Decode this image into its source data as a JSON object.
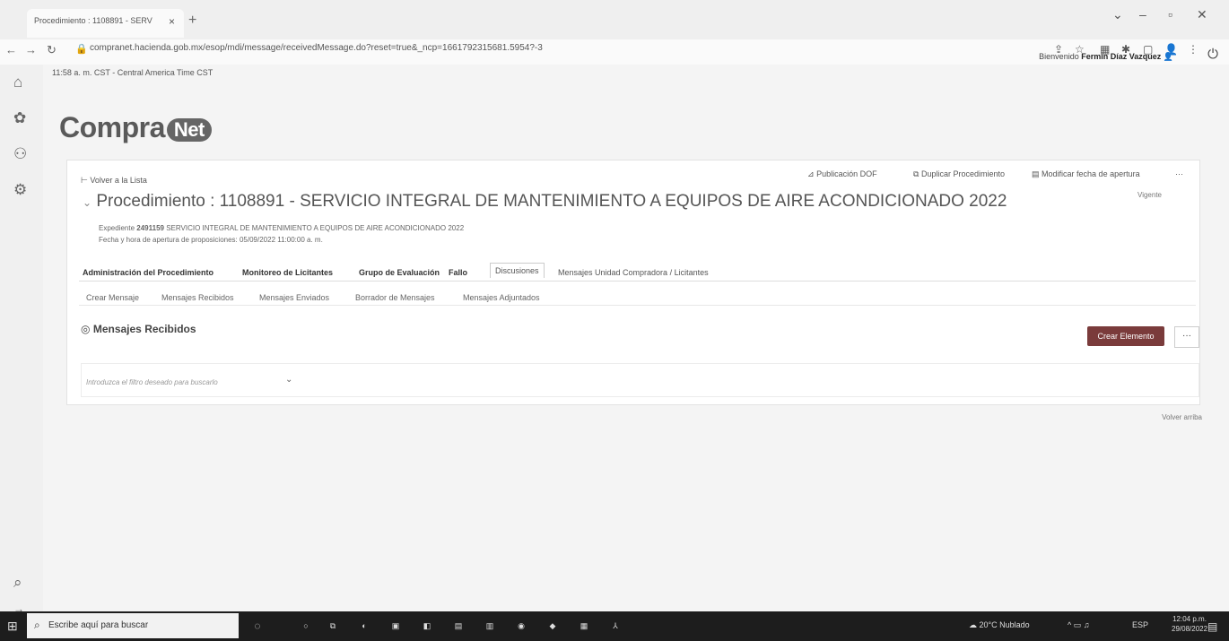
{
  "browser": {
    "tab_title": "Procedimiento : 1108891 - SERV",
    "url": "compranet.hacienda.gob.mx/esop/mdi/message/receivedMessage.do?reset=true&_ncp=1661792315681.5954?-3"
  },
  "header": {
    "welcome_prefix": "Bienvenido",
    "user_name": "Fermín Díaz Vazquez",
    "time_info": "11:58 a. m. CST - Central America Time CST"
  },
  "logo": {
    "part1": "Compra",
    "part2": "Net"
  },
  "toolbar": {
    "back": "Volver a la Lista",
    "publish": "Publicación DOF",
    "duplicate": "Duplicar Procedimiento",
    "modify_date": "Modificar fecha de apertura",
    "more": "···"
  },
  "procedure": {
    "title": "Procedimiento : 1108891 - SERVICIO INTEGRAL DE MANTENIMIENTO A EQUIPOS DE AIRE ACONDICIONADO 2022",
    "status": "Vigente",
    "expediente_label": "Expediente",
    "expediente_value": "2491159",
    "expediente_desc": "SERVICIO INTEGRAL DE MANTENIMIENTO A EQUIPOS DE AIRE ACONDICIONADO 2022",
    "opening": "Fecha y hora de apertura de proposiciones: 05/09/2022 11:00:00 a. m."
  },
  "main_tabs": [
    "Administración del Procedimiento",
    "Monitoreo de Licitantes",
    "Grupo de Evaluación",
    "Fallo",
    "Discusiones",
    "Mensajes Unidad Compradora / Licitantes"
  ],
  "sub_tabs": [
    "Crear Mensaje",
    "Mensajes Recibidos",
    "Mensajes Enviados",
    "Borrador de Mensajes",
    "Mensajes Adjuntados"
  ],
  "section": {
    "title": "Mensajes Recibidos",
    "create_button": "Crear Elemento",
    "more": "···",
    "filter_placeholder": "Introduzca el filtro deseado para buscarlo"
  },
  "footer": {
    "back_to_top": "Volver arriba"
  },
  "taskbar": {
    "search_placeholder": "Escribe aquí para buscar",
    "weather": "20°C Nublado",
    "lang": "ESP",
    "time": "12:04 p.m.",
    "date": "29/08/2022"
  },
  "colors": {
    "accent_button": "#7a3b3b",
    "taskbar": "#1d1d1d"
  }
}
